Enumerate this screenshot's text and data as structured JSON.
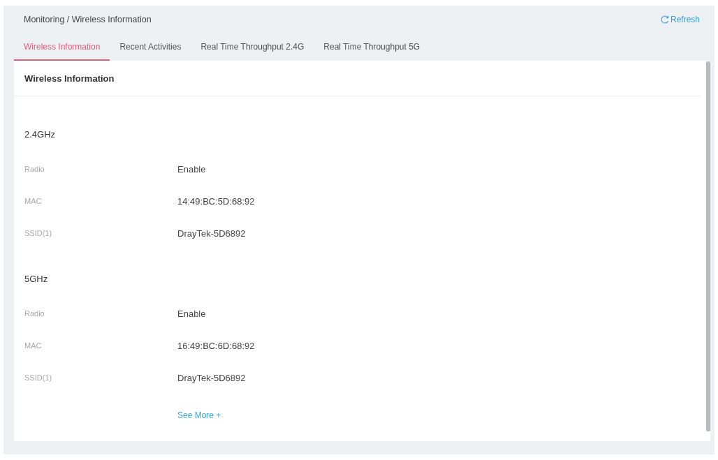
{
  "header": {
    "breadcrumb": "Monitoring / Wireless Information",
    "refresh": "Refresh"
  },
  "tabs": [
    {
      "label": "Wireless Information",
      "selected": true
    },
    {
      "label": "Recent Activities",
      "selected": false
    },
    {
      "label": "Real Time Throughput 2.4G",
      "selected": false
    },
    {
      "label": "Real Time Throughput 5G",
      "selected": false
    }
  ],
  "card": {
    "title": "Wireless Information",
    "sections": [
      {
        "title": "2.4GHz",
        "rows": [
          {
            "label": "Radio",
            "value": "Enable"
          },
          {
            "label": "MAC",
            "value": "14:49:BC:5D:68:92"
          },
          {
            "label": "SSID(1)",
            "value": "DrayTek-5D6892"
          }
        ]
      },
      {
        "title": "5GHz",
        "rows": [
          {
            "label": "Radio",
            "value": "Enable"
          },
          {
            "label": "MAC",
            "value": "16:49:BC:6D:68:92"
          },
          {
            "label": "SSID(1)",
            "value": "DrayTek-5D6892"
          }
        ]
      }
    ],
    "see_more": "See More +"
  }
}
